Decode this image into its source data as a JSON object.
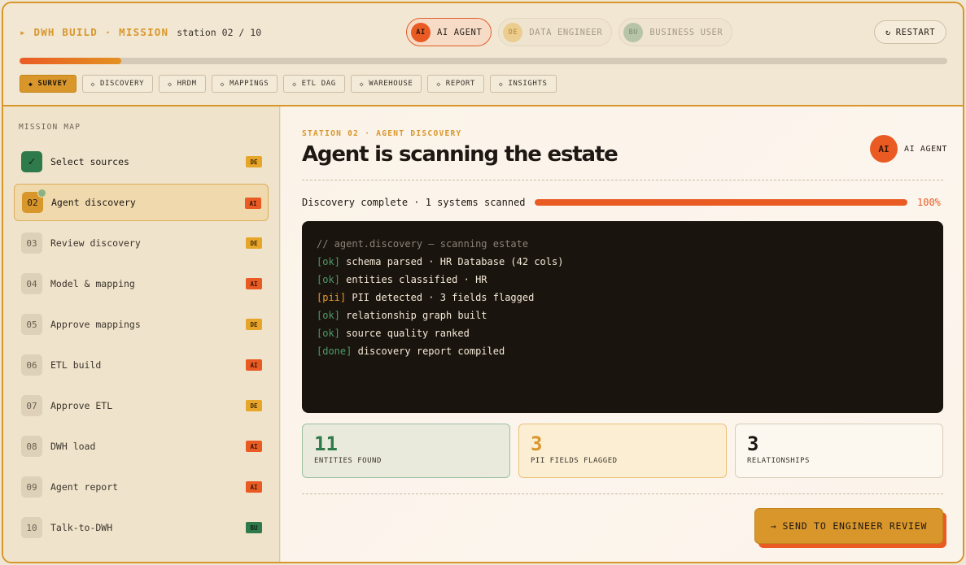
{
  "header": {
    "brand_marker": "▸",
    "brand_title": "DWH BUILD · MISSION",
    "station": "station 02 / 10",
    "restart_icon": "↻",
    "restart_label": "RESTART",
    "progress": 0.11
  },
  "roles": [
    {
      "initials": "AI",
      "label": "AI AGENT",
      "active": true
    },
    {
      "initials": "DE",
      "label": "DATA ENGINEER",
      "active": false
    },
    {
      "initials": "BU",
      "label": "BUSINESS USER",
      "active": false
    }
  ],
  "steps": [
    {
      "mark": "◆",
      "label": "SURVEY",
      "active": true
    },
    {
      "mark": "◇",
      "label": "DISCOVERY"
    },
    {
      "mark": "◇",
      "label": "HRDM"
    },
    {
      "mark": "◇",
      "label": "MAPPINGS"
    },
    {
      "mark": "◇",
      "label": "ETL DAG"
    },
    {
      "mark": "◇",
      "label": "WAREHOUSE"
    },
    {
      "mark": "◇",
      "label": "REPORT"
    },
    {
      "mark": "◇",
      "label": "INSIGHTS"
    }
  ],
  "sidebar": {
    "title": "MISSION MAP",
    "items": [
      {
        "num": "✓",
        "label": "Select sources",
        "badge": "DE",
        "state": "done"
      },
      {
        "num": "02",
        "label": "Agent discovery",
        "badge": "AI",
        "state": "current"
      },
      {
        "num": "03",
        "label": "Review discovery",
        "badge": "DE",
        "state": "pending"
      },
      {
        "num": "04",
        "label": "Model & mapping",
        "badge": "AI",
        "state": "pending"
      },
      {
        "num": "05",
        "label": "Approve mappings",
        "badge": "DE",
        "state": "pending"
      },
      {
        "num": "06",
        "label": "ETL build",
        "badge": "AI",
        "state": "pending"
      },
      {
        "num": "07",
        "label": "Approve ETL",
        "badge": "DE",
        "state": "pending"
      },
      {
        "num": "08",
        "label": "DWH load",
        "badge": "AI",
        "state": "pending"
      },
      {
        "num": "09",
        "label": "Agent report",
        "badge": "AI",
        "state": "pending"
      },
      {
        "num": "10",
        "label": "Talk-to-DWH",
        "badge": "BU",
        "state": "pending"
      }
    ]
  },
  "main": {
    "eyebrow": "STATION 02 · AGENT DISCOVERY",
    "title": "Agent is scanning the estate",
    "agent_initials": "AI",
    "agent_label": "AI AGENT",
    "scan_status": "Discovery complete · 1 systems scanned",
    "scan_progress": 1.0,
    "scan_pct": "100%",
    "terminal": {
      "comment": "// agent.discovery — scanning estate",
      "lines": [
        {
          "tag": "[ok]",
          "kind": "ok",
          "text": "schema parsed · HR Database (42 cols)"
        },
        {
          "tag": "[ok]",
          "kind": "ok",
          "text": "entities classified · HR"
        },
        {
          "tag": "[pii]",
          "kind": "pii",
          "text": "PII detected · 3 fields flagged"
        },
        {
          "tag": "[ok]",
          "kind": "ok",
          "text": "relationship graph built"
        },
        {
          "tag": "[ok]",
          "kind": "ok",
          "text": "source quality ranked"
        },
        {
          "tag": "[done]",
          "kind": "ok",
          "text": "discovery report compiled"
        }
      ]
    },
    "stats": [
      {
        "value": "11",
        "label": "ENTITIES FOUND",
        "tone": "green"
      },
      {
        "value": "3",
        "label": "PII FIELDS FLAGGED",
        "tone": "amber"
      },
      {
        "value": "3",
        "label": "RELATIONSHIPS",
        "tone": "plain"
      }
    ],
    "send_icon": "→",
    "send_label": "SEND TO ENGINEER REVIEW"
  },
  "colors": {
    "accent_amber": "#d9962a",
    "accent_orange": "#ea5b24",
    "accent_green": "#2f7a4b",
    "terminal_bg": "#1a140e"
  }
}
